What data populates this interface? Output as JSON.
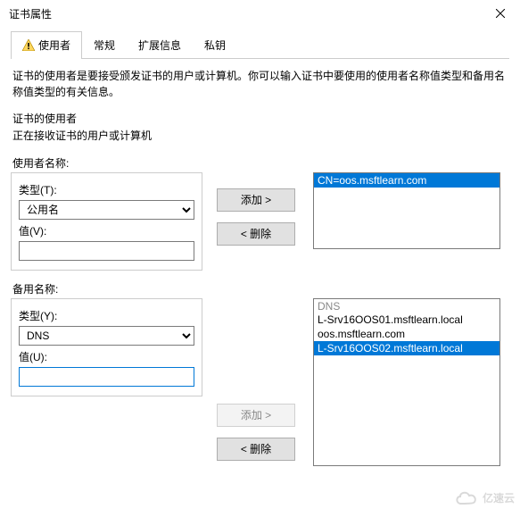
{
  "window": {
    "title": "证书属性"
  },
  "tabs": {
    "items": [
      {
        "label": "使用者",
        "active": true
      },
      {
        "label": "常规"
      },
      {
        "label": "扩展信息"
      },
      {
        "label": "私钥"
      }
    ]
  },
  "description": "证书的使用者是要接受颁发证书的用户或计算机。你可以输入证书中要使用的使用者名称值类型和备用名称值类型的有关信息。",
  "subject_heading": "证书的使用者",
  "subject_sub": "正在接收证书的用户或计算机",
  "subject": {
    "section_label": "使用者名称:",
    "type_label": "类型(T):",
    "type_value": "公用名",
    "value_label": "值(V):",
    "value": "",
    "add_label": "添加 >",
    "remove_label": "< 删除",
    "list": [
      {
        "text": "CN=oos.msftlearn.com",
        "selected": true
      }
    ]
  },
  "altname": {
    "section_label": "备用名称:",
    "type_label": "类型(Y):",
    "type_value": "DNS",
    "value_label": "值(U):",
    "value": "",
    "add_label": "添加 >",
    "remove_label": "< 删除",
    "list_header": "DNS",
    "list": [
      {
        "text": "L-Srv16OOS01.msftlearn.local",
        "selected": false
      },
      {
        "text": "oos.msftlearn.com",
        "selected": false
      },
      {
        "text": "L-Srv16OOS02.msftlearn.local",
        "selected": true
      }
    ]
  },
  "watermark": "亿速云"
}
